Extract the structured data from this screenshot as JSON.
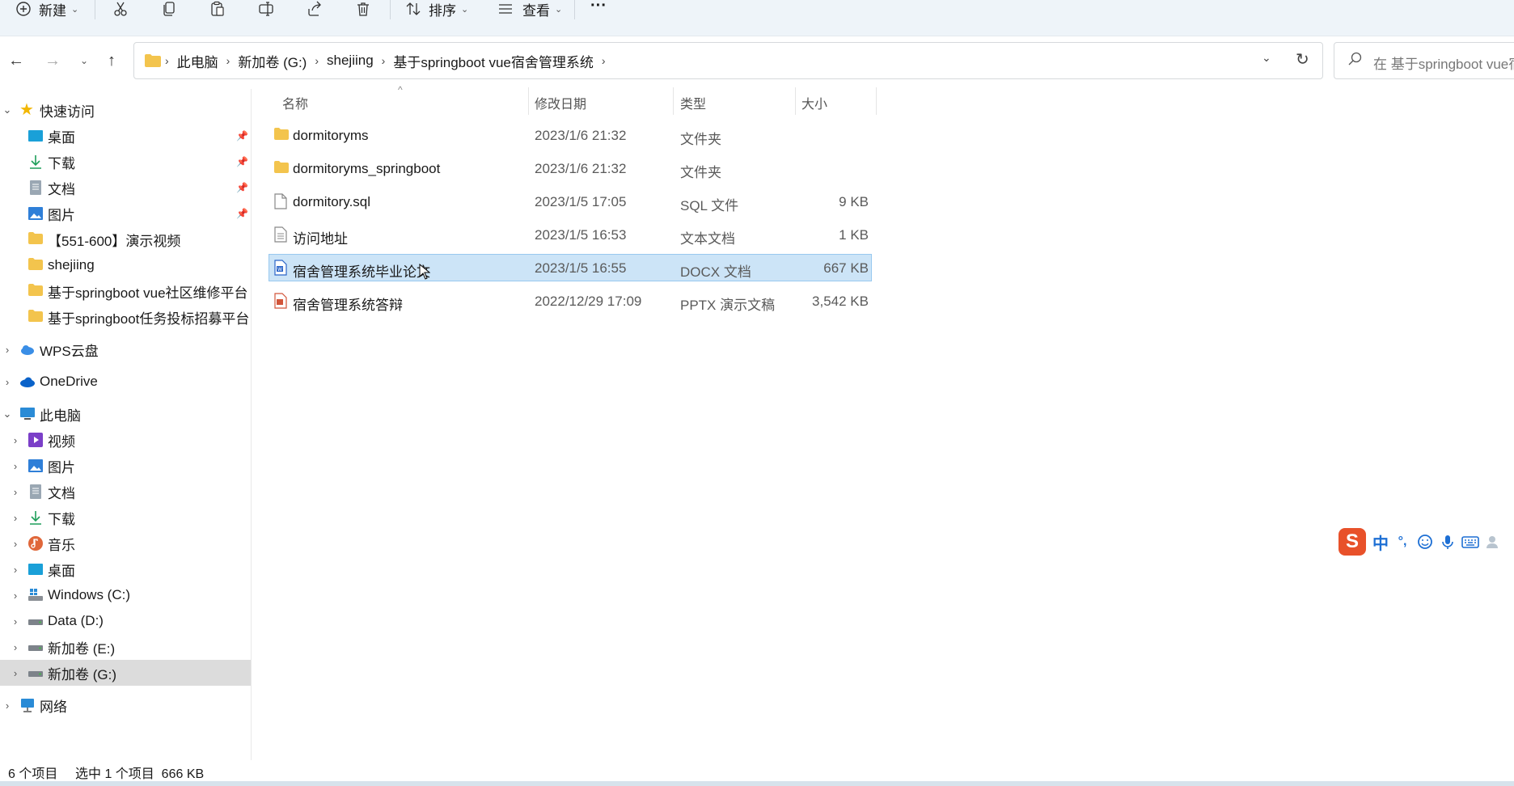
{
  "toolbar": {
    "new_label": "新建",
    "sort_label": "排序",
    "view_label": "查看",
    "more_label": "···"
  },
  "address": {
    "crumbs": [
      "此电脑",
      "新加卷 (G:)",
      "shejiing",
      "基于springboot vue宿舍管理系统"
    ]
  },
  "search": {
    "placeholder": "在 基于springboot vue宿"
  },
  "sidebar": {
    "quick_access": "快速访问",
    "quick_items": [
      "桌面",
      "下载",
      "文档",
      "图片",
      "【551-600】演示视频",
      "shejiing",
      "基于springboot vue社区维修平台",
      "基于springboot任务投标招募平台"
    ],
    "wps": "WPS云盘",
    "onedrive": "OneDrive",
    "this_pc": "此电脑",
    "pc_items": [
      "视频",
      "图片",
      "文档",
      "下载",
      "音乐",
      "桌面",
      "Windows (C:)",
      "Data (D:)",
      "新加卷 (E:)",
      "新加卷 (G:)"
    ],
    "network": "网络"
  },
  "columns": {
    "name": "名称",
    "date": "修改日期",
    "type": "类型",
    "size": "大小"
  },
  "files": [
    {
      "name": "dormitoryms",
      "date": "2023/1/6 21:32",
      "type": "文件夹",
      "size": "",
      "icon": "folder-icon"
    },
    {
      "name": "dormitoryms_springboot",
      "date": "2023/1/6 21:32",
      "type": "文件夹",
      "size": "",
      "icon": "folder-icon"
    },
    {
      "name": "dormitory.sql",
      "date": "2023/1/5 17:05",
      "type": "SQL 文件",
      "size": "9 KB",
      "icon": "file-icon"
    },
    {
      "name": "访问地址",
      "date": "2023/1/5 16:53",
      "type": "文本文档",
      "size": "1 KB",
      "icon": "text-file-icon"
    },
    {
      "name": "宿舍管理系统毕业论文",
      "date": "2023/1/5 16:55",
      "type": "DOCX 文档",
      "size": "667 KB",
      "icon": "docx-icon"
    },
    {
      "name": "宿舍管理系统答辩",
      "date": "2022/12/29 17:09",
      "type": "PPTX 演示文稿",
      "size": "3,542 KB",
      "icon": "pptx-icon"
    }
  ],
  "status": {
    "count": "6 个项目",
    "selected": "选中 1 个项目  666 KB"
  },
  "ime": {
    "mode": "中",
    "punct": "°,"
  },
  "colors": {
    "accent": "#0067c0",
    "selection": "#cce4f7",
    "folder": "#f3c44d"
  }
}
